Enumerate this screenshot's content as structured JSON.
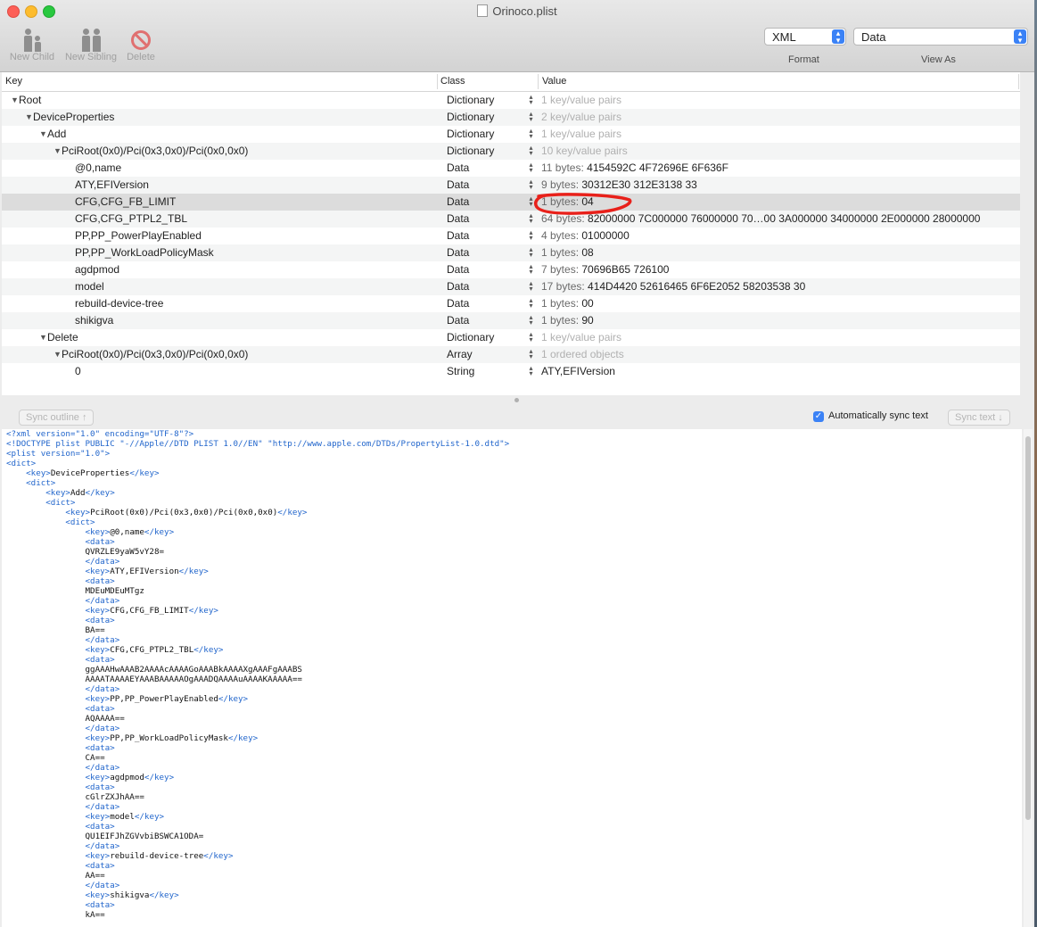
{
  "window": {
    "title": "Orinoco.plist"
  },
  "toolbar": {
    "new_child_label": "New Child",
    "new_sibling_label": "New Sibling",
    "delete_label": "Delete",
    "format_value": "XML",
    "format_label": "Format",
    "view_as_value": "Data",
    "view_as_label": "View As"
  },
  "outline": {
    "columns": {
      "key": "Key",
      "class": "Class",
      "value": "Value"
    },
    "rows": [
      {
        "key": "Root",
        "class": "Dictionary",
        "value": "1 key/value pairs"
      },
      {
        "key": "DeviceProperties",
        "class": "Dictionary",
        "value": "2 key/value pairs"
      },
      {
        "key": "Add",
        "class": "Dictionary",
        "value": "1 key/value pairs"
      },
      {
        "key": "PciRoot(0x0)/Pci(0x3,0x0)/Pci(0x0,0x0)",
        "class": "Dictionary",
        "value": "10 key/value pairs"
      },
      {
        "key": "@0,name",
        "class": "Data",
        "value_label": "11 bytes:",
        "value": "4154592C 4F72696E 6F636F"
      },
      {
        "key": "ATY,EFIVersion",
        "class": "Data",
        "value_label": "9 bytes:",
        "value": "30312E30 312E3138 33"
      },
      {
        "key": "CFG,CFG_FB_LIMIT",
        "class": "Data",
        "value_label": "1 bytes:",
        "value": "04"
      },
      {
        "key": "CFG,CFG_PTPL2_TBL",
        "class": "Data",
        "value_label": "64 bytes:",
        "value": "82000000 7C000000 76000000 70…00 3A000000 34000000 2E000000 28000000"
      },
      {
        "key": "PP,PP_PowerPlayEnabled",
        "class": "Data",
        "value_label": "4 bytes:",
        "value": "01000000"
      },
      {
        "key": "PP,PP_WorkLoadPolicyMask",
        "class": "Data",
        "value_label": "1 bytes:",
        "value": "08"
      },
      {
        "key": "agdpmod",
        "class": "Data",
        "value_label": "7 bytes:",
        "value": "70696B65 726100"
      },
      {
        "key": "model",
        "class": "Data",
        "value_label": "17 bytes:",
        "value": "414D4420 52616465 6F6E2052 58203538 30"
      },
      {
        "key": "rebuild-device-tree",
        "class": "Data",
        "value_label": "1 bytes:",
        "value": "00"
      },
      {
        "key": "shikigva",
        "class": "Data",
        "value_label": "1 bytes:",
        "value": "90"
      },
      {
        "key": "Delete",
        "class": "Dictionary",
        "value": "1 key/value pairs"
      },
      {
        "key": "PciRoot(0x0)/Pci(0x3,0x0)/Pci(0x0,0x0)",
        "class": "Array",
        "value": "1 ordered objects"
      },
      {
        "key": "0",
        "class": "String",
        "value": "ATY,EFIVersion"
      }
    ]
  },
  "sync": {
    "sync_outline_label": "Sync outline ↑",
    "auto_sync_label": "Automatically sync text",
    "sync_text_label": "Sync text ↓"
  },
  "xml_text": {
    "lines": [
      "<?xml version=\"1.0\" encoding=\"UTF-8\"?>",
      "<!DOCTYPE plist PUBLIC \"-//Apple//DTD PLIST 1.0//EN\" \"http://www.apple.com/DTDs/PropertyList-1.0.dtd\">",
      "<plist version=\"1.0\">",
      "<dict>",
      "    <key>DeviceProperties</key>",
      "    <dict>",
      "        <key>Add</key>",
      "        <dict>",
      "            <key>PciRoot(0x0)/Pci(0x3,0x0)/Pci(0x0,0x0)</key>",
      "            <dict>",
      "                <key>@0,name</key>",
      "                <data>",
      "                QVRZLE9yaW5vY28=",
      "                </data>",
      "                <key>ATY,EFIVersion</key>",
      "                <data>",
      "                MDEuMDEuMTgz",
      "                </data>",
      "                <key>CFG,CFG_FB_LIMIT</key>",
      "                <data>",
      "                BA==",
      "                </data>",
      "                <key>CFG,CFG_PTPL2_TBL</key>",
      "                <data>",
      "                ggAAAHwAAAB2AAAAcAAAAGoAAABkAAAAXgAAAFgAAABS",
      "                AAAATAAAAEYAAABAAAAAOgAAADQAAAAuAAAAKAAAAA==",
      "                </data>",
      "                <key>PP,PP_PowerPlayEnabled</key>",
      "                <data>",
      "                AQAAAA==",
      "                </data>",
      "                <key>PP,PP_WorkLoadPolicyMask</key>",
      "                <data>",
      "                CA==",
      "                </data>",
      "                <key>agdpmod</key>",
      "                <data>",
      "                cGlrZXJhAA==",
      "                </data>",
      "                <key>model</key>",
      "                <data>",
      "                QU1EIFJhZGVvbiBSWCA1ODA=",
      "                </data>",
      "                <key>rebuild-device-tree</key>",
      "                <data>",
      "                AA==",
      "                </data>",
      "                <key>shikigva</key>",
      "                <data>",
      "                kA=="
    ]
  },
  "colors": {
    "annotation": "#e8201a",
    "xml_tag": "#2266cc",
    "accent": "#3b82f6"
  }
}
